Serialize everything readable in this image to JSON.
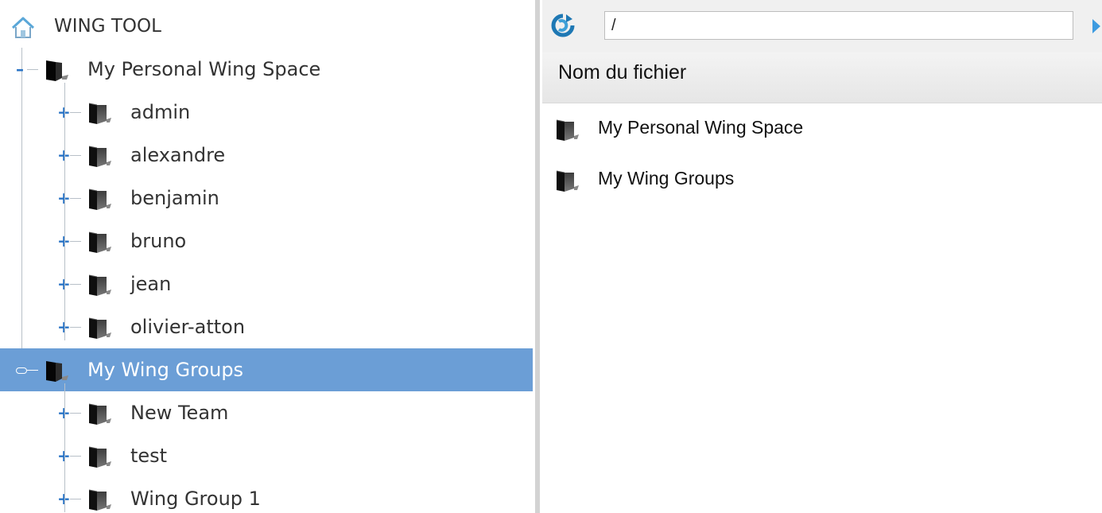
{
  "tree": {
    "root_label": "WING TOOL",
    "nodes": [
      {
        "label": "My Personal Wing Space",
        "level": 1,
        "toggle": "-",
        "selected": false
      },
      {
        "label": "admin",
        "level": 2,
        "toggle": "+",
        "selected": false
      },
      {
        "label": "alexandre",
        "level": 2,
        "toggle": "+",
        "selected": false
      },
      {
        "label": "benjamin",
        "level": 2,
        "toggle": "+",
        "selected": false
      },
      {
        "label": "bruno",
        "level": 2,
        "toggle": "+",
        "selected": false
      },
      {
        "label": "jean",
        "level": 2,
        "toggle": "+",
        "selected": false
      },
      {
        "label": "olivier-atton",
        "level": 2,
        "toggle": "+",
        "selected": false
      },
      {
        "label": "My Wing Groups",
        "level": 1,
        "toggle": "-",
        "selected": true
      },
      {
        "label": "New Team",
        "level": 2,
        "toggle": "+",
        "selected": false
      },
      {
        "label": "test",
        "level": 2,
        "toggle": "+",
        "selected": false
      },
      {
        "label": "Wing Group 1",
        "level": 2,
        "toggle": "+",
        "selected": false
      }
    ]
  },
  "browser": {
    "path_value": "/",
    "column_header": "Nom du fichier",
    "files": [
      {
        "name": "My Personal Wing Space",
        "icon": "folder-icon"
      },
      {
        "name": "My Wing Groups",
        "icon": "folder-icon"
      }
    ]
  },
  "colors": {
    "selection": "#6b9ed6",
    "toggle": "#2a74c6",
    "splitter": "#d3d3d3"
  }
}
